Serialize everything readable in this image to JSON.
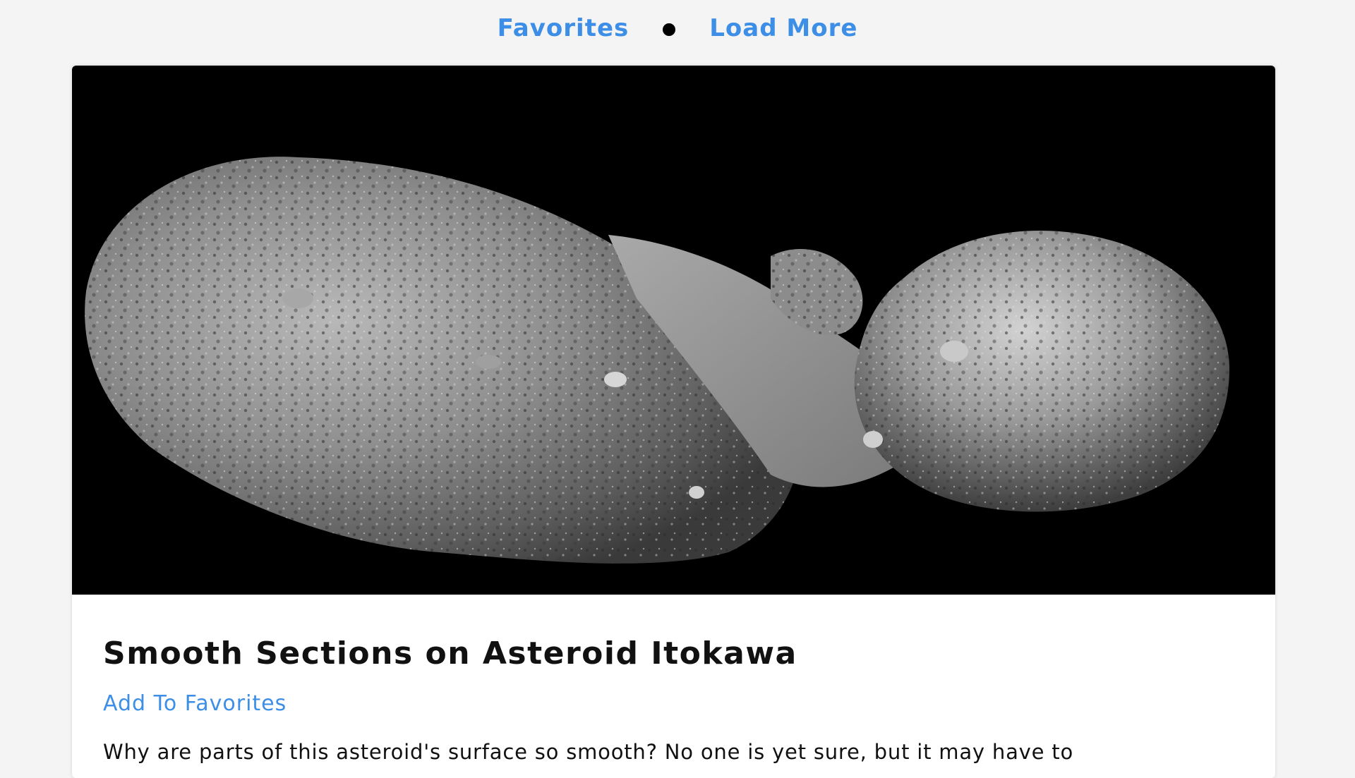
{
  "nav": {
    "favorites_label": "Favorites",
    "load_more_label": "Load More",
    "separator": "•",
    "link_color": "#3d8ee6"
  },
  "card": {
    "image_icon": "asteroid-photo",
    "title": "Smooth Sections on Asteroid Itokawa",
    "favorite_label": "Add To Favorites",
    "description": "Why are parts of this asteroid's surface so smooth? No one is yet sure, but it may have to"
  }
}
